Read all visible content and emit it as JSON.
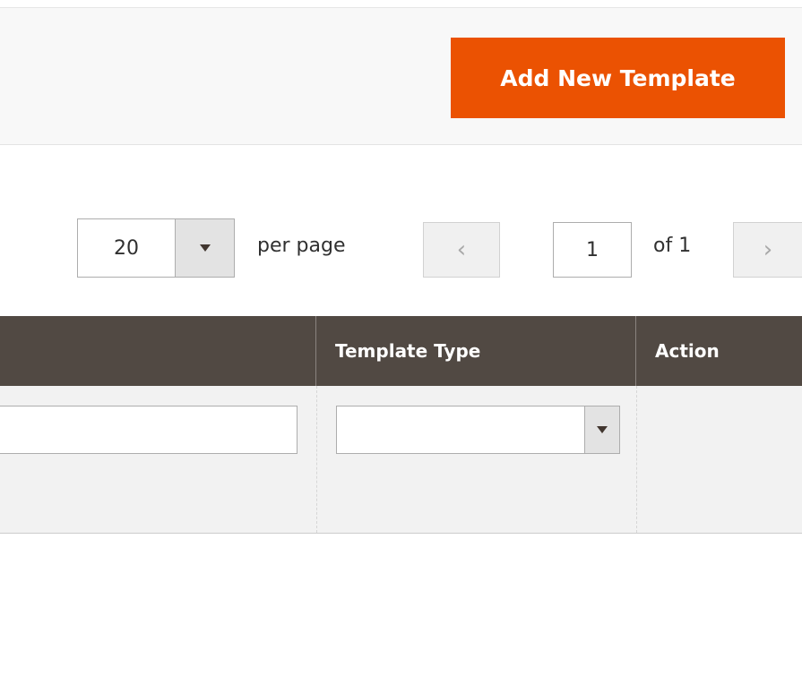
{
  "toolbar": {
    "add_button_label": "Add New Template"
  },
  "pager": {
    "per_page_value": "20",
    "per_page_label": "per page",
    "prev_glyph": "‹",
    "current_page": "1",
    "of_pages": "of 1",
    "next_glyph": "›"
  },
  "grid": {
    "columns": [
      {
        "label": ""
      },
      {
        "label": "Template Type"
      },
      {
        "label": "Action"
      }
    ],
    "filters": {
      "text_filter_value": "",
      "type_filter_value": ""
    }
  },
  "colors": {
    "accent": "#eb5202",
    "grid_header": "#514943"
  },
  "icons": {
    "per_page_toggle": "chevron-down-icon",
    "prev": "chevron-left-icon",
    "next": "chevron-right-icon",
    "type_filter_toggle": "chevron-down-icon"
  }
}
